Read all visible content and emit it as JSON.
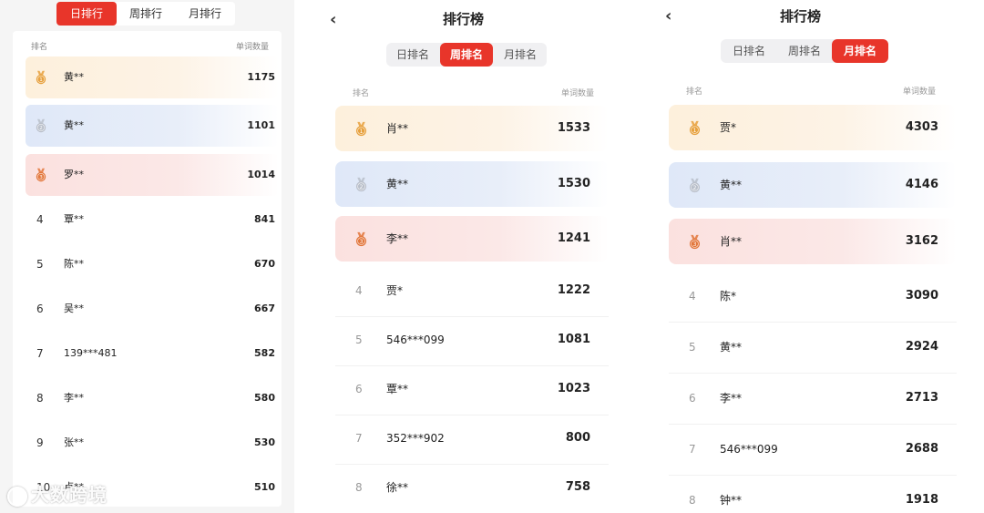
{
  "daily": {
    "tabs": [
      "日排行",
      "周排行",
      "月排行"
    ],
    "active_tab": 0,
    "headers": {
      "rank": "排名",
      "count": "单词数量"
    },
    "rows": [
      {
        "rank": "1",
        "name": "黄**",
        "value": "1175",
        "medal": "gold"
      },
      {
        "rank": "2",
        "name": "黄**",
        "value": "1101",
        "medal": "silver"
      },
      {
        "rank": "3",
        "name": "罗**",
        "value": "1014",
        "medal": "bronze"
      },
      {
        "rank": "4",
        "name": "覃**",
        "value": "841"
      },
      {
        "rank": "5",
        "name": "陈**",
        "value": "670"
      },
      {
        "rank": "6",
        "name": "吴**",
        "value": "667"
      },
      {
        "rank": "7",
        "name": "139***481",
        "value": "582"
      },
      {
        "rank": "8",
        "name": "李**",
        "value": "580"
      },
      {
        "rank": "9",
        "name": "张**",
        "value": "530"
      },
      {
        "rank": "10",
        "name": "卢**",
        "value": "510"
      }
    ]
  },
  "weekly": {
    "title": "排行榜",
    "tabs": [
      "日排名",
      "周排名",
      "月排名"
    ],
    "active_tab": 1,
    "headers": {
      "rank": "排名",
      "count": "单词数量"
    },
    "rows": [
      {
        "rank": "1",
        "name": "肖**",
        "value": "1533",
        "medal": "gold"
      },
      {
        "rank": "2",
        "name": "黄**",
        "value": "1530",
        "medal": "silver"
      },
      {
        "rank": "3",
        "name": "李**",
        "value": "1241",
        "medal": "bronze"
      },
      {
        "rank": "4",
        "name": "贾*",
        "value": "1222"
      },
      {
        "rank": "5",
        "name": "546***099",
        "value": "1081"
      },
      {
        "rank": "6",
        "name": "覃**",
        "value": "1023"
      },
      {
        "rank": "7",
        "name": "352***902",
        "value": "800"
      },
      {
        "rank": "8",
        "name": "徐**",
        "value": "758"
      }
    ]
  },
  "monthly": {
    "title": "排行榜",
    "tabs": [
      "日排名",
      "周排名",
      "月排名"
    ],
    "active_tab": 2,
    "headers": {
      "rank": "排名",
      "count": "单词数量"
    },
    "rows": [
      {
        "rank": "1",
        "name": "贾*",
        "value": "4303",
        "medal": "gold"
      },
      {
        "rank": "2",
        "name": "黄**",
        "value": "4146",
        "medal": "silver"
      },
      {
        "rank": "3",
        "name": "肖**",
        "value": "3162",
        "medal": "bronze"
      },
      {
        "rank": "4",
        "name": "陈*",
        "value": "3090"
      },
      {
        "rank": "5",
        "name": "黄**",
        "value": "2924"
      },
      {
        "rank": "6",
        "name": "李**",
        "value": "2713"
      },
      {
        "rank": "7",
        "name": "546***099",
        "value": "2688"
      },
      {
        "rank": "8",
        "name": "钟**",
        "value": "1918"
      }
    ]
  },
  "colors": {
    "accent": "#e8352a",
    "gold": "#e7a03c",
    "silver": "#b9bfca",
    "bronze": "#e2753a"
  },
  "icons": {
    "back": "chevron-left-icon",
    "medal": "medal-icon"
  },
  "watermark": "大数跨境"
}
